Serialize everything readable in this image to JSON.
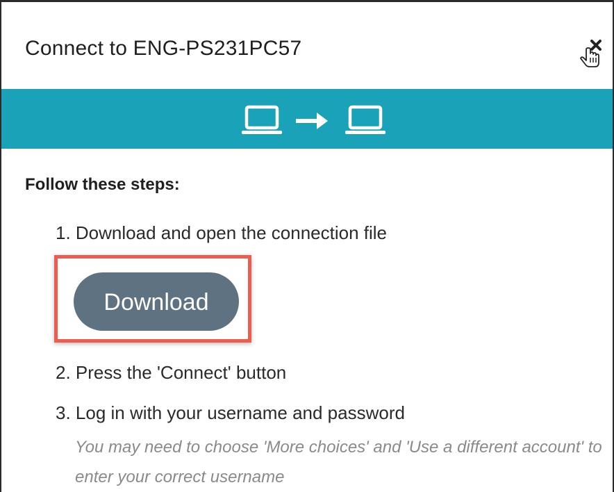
{
  "dialog": {
    "title": "Connect to ENG-PS231PC57",
    "close_icon": "close-icon",
    "banner_color": "#1aa3b8",
    "banner_icons": [
      "laptop-icon",
      "arrow-right-icon",
      "laptop-icon"
    ]
  },
  "instructions": {
    "heading": "Follow these steps:",
    "step1": "1. Download and open the connection file",
    "download_label": "Download",
    "step2": "2. Press the 'Connect' button",
    "step3": "3. Log in with your username and password",
    "hint": "You may need to choose 'More choices' and 'Use a different account' to enter your correct username"
  },
  "colors": {
    "accent": "#1aa3b8",
    "button": "#5f7281",
    "highlight": "#ee5b4f",
    "hint_text": "#8a8a8a"
  }
}
